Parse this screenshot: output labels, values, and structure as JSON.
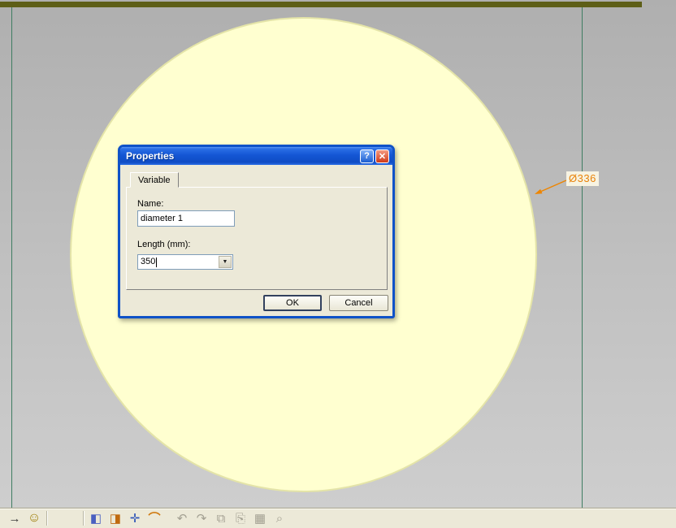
{
  "viewport": {
    "dimension_label": "Ø336"
  },
  "dialog": {
    "title": "Properties",
    "help_glyph": "?",
    "close_glyph": "✕",
    "tab_label": "Variable",
    "name_label": "Name:",
    "name_value": "diameter 1",
    "length_label": "Length (mm):",
    "length_value": "350",
    "ok_label": "OK",
    "cancel_label": "Cancel"
  },
  "toolbar": {
    "left": [
      {
        "name": "exit-workbench-icon",
        "glyph": "→"
      },
      {
        "name": "smiley-icon",
        "glyph": "☺"
      }
    ],
    "sketch_tools": [
      {
        "name": "sketch-analysis-icon",
        "glyph": "◧"
      },
      {
        "name": "constraint-diagnostic-icon",
        "glyph": "◨"
      },
      {
        "name": "geometric-constraint-icon",
        "glyph": "✛"
      },
      {
        "name": "dimensional-constraint-icon",
        "glyph": "⌒"
      }
    ],
    "disabled_tools": [
      {
        "name": "undo-icon",
        "glyph": "↶"
      },
      {
        "name": "redo-icon",
        "glyph": "↷"
      },
      {
        "name": "copy-icon",
        "glyph": "⧉"
      },
      {
        "name": "paste-icon",
        "glyph": "⎘"
      },
      {
        "name": "grid-icon",
        "glyph": "▦"
      },
      {
        "name": "search-icon",
        "glyph": "⌕"
      }
    ]
  },
  "colors": {
    "titlebar_blue": "#1456d4",
    "circle_fill": "#ffffd0",
    "annotation_orange": "#ee8500",
    "dialog_face": "#ece9d8"
  }
}
